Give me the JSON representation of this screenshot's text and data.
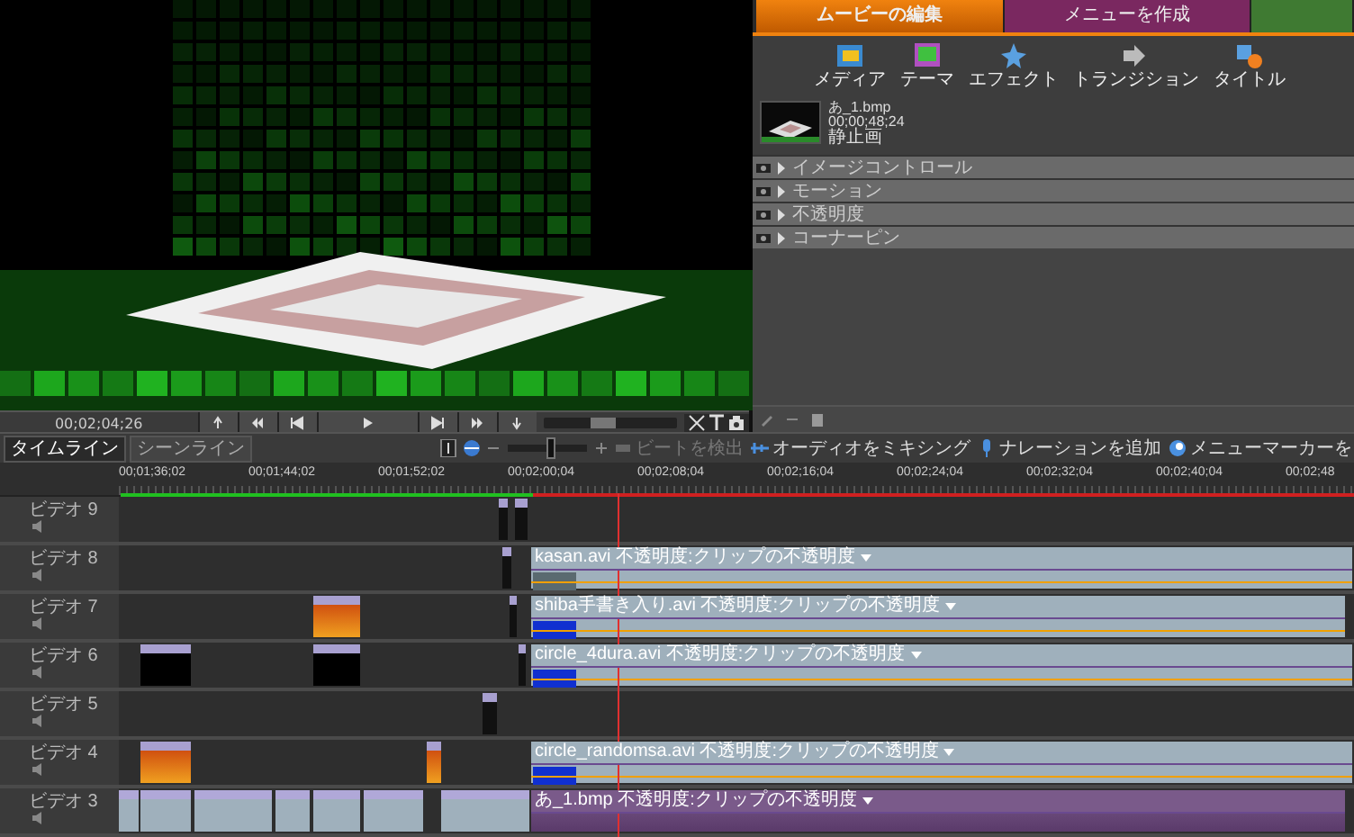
{
  "preview": {
    "timecode": "00;02;04;26",
    "jog": {
      "level": 0.45
    }
  },
  "task_tabs": [
    {
      "label": "ムービーの編集",
      "selected": true,
      "color": "#f0820f"
    },
    {
      "label": "メニューを作成",
      "selected": false,
      "color": "#7a2860"
    },
    {
      "selected": false,
      "color": "#3f7a32"
    }
  ],
  "tools": [
    {
      "label": "メディア",
      "kind": "media"
    },
    {
      "label": "テーマ",
      "kind": "theme"
    },
    {
      "label": "エフェクト",
      "kind": "effect"
    },
    {
      "label": "トランジション",
      "kind": "transition"
    },
    {
      "label": "タイトル",
      "kind": "title"
    }
  ],
  "clip_info": {
    "name": "あ_1.bmp",
    "duration": "00;00;48;24",
    "type": "静止画"
  },
  "effects": [
    {
      "label": "イメージコントロール",
      "expanded": false
    },
    {
      "label": "モーション",
      "expanded": false
    },
    {
      "label": "不透明度",
      "expanded": false
    },
    {
      "label": "コーナーピン",
      "expanded": false
    }
  ],
  "timeline_tabs": [
    {
      "label": "タイムライン",
      "selected": true
    },
    {
      "label": "シーンライン",
      "selected": false
    }
  ],
  "zoom": {
    "level": 0.55
  },
  "actions": [
    {
      "label": "ビートを検出",
      "kind": "beat",
      "disabled": true
    },
    {
      "label": "オーディオをミキシング",
      "kind": "mixer",
      "disabled": false
    },
    {
      "label": "ナレーションを追加",
      "kind": "mic",
      "disabled": false
    },
    {
      "label": "メニューマーカーを",
      "kind": "marker",
      "disabled": false
    }
  ],
  "ruler": [
    "00;01;36;02",
    "00;01;44;02",
    "00;01;52;02",
    "00;02;00;04",
    "00;02;08;04",
    "00;02;16;04",
    "00;02;24;04",
    "00;02;32;04",
    "00;02;40;04",
    "00;02;48"
  ],
  "tracks": [
    {
      "name": "ビデオ 9"
    },
    {
      "name": "ビデオ 8",
      "clips": [
        {
          "label": "kasan.avi 不透明度:クリップの不透明度",
          "kind": "video"
        }
      ]
    },
    {
      "name": "ビデオ 7",
      "clips": [
        {
          "label": "shiba手書き入り.avi 不透明度:クリップの不透明度",
          "kind": "video"
        }
      ]
    },
    {
      "name": "ビデオ 6",
      "clips": [
        {
          "label": "circle_4dura.avi 不透明度:クリップの不透明度",
          "kind": "video"
        }
      ]
    },
    {
      "name": "ビデオ 5"
    },
    {
      "name": "ビデオ 4",
      "clips": [
        {
          "label": "circle_randomsa.avi 不透明度:クリップの不透明度",
          "kind": "video"
        }
      ]
    },
    {
      "name": "ビデオ 3",
      "clips": [
        {
          "label": "あ_1.bmp 不透明度:クリップの不透明度",
          "kind": "image"
        }
      ]
    }
  ]
}
